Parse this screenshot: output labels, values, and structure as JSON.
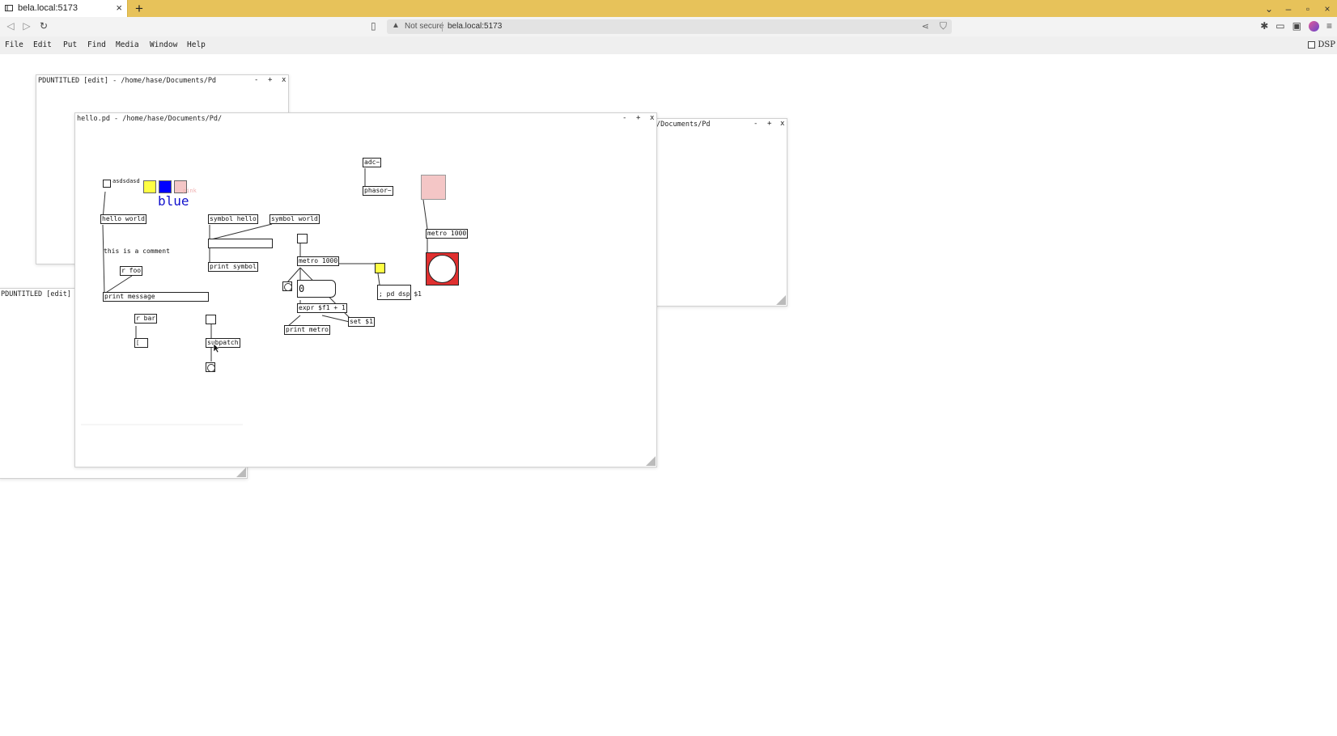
{
  "browser": {
    "tab_title": "bela.local:5173",
    "tab_close": "×",
    "new_tab": "+",
    "security_label": "Not secure",
    "url": "bela.local:5173",
    "win_controls": [
      "⌄",
      "–",
      "▫",
      "×"
    ]
  },
  "menu": {
    "items": [
      "File",
      "Edit",
      "Put",
      "Find",
      "Media",
      "Window",
      "Help"
    ],
    "dsp_label": "DSP"
  },
  "windows": {
    "untitled_top": {
      "title": "PDUNTITLED [edit] - /home/hase/Documents/Pd",
      "min": "-",
      "max": "+",
      "close": "x"
    },
    "untitled_left": {
      "title": "PDUNTITLED [edit] -"
    },
    "docs_right": {
      "title": "/Documents/Pd",
      "min": "-",
      "max": "+",
      "close": "x"
    },
    "hello": {
      "title": "hello.pd - /home/hase/Documents/Pd/",
      "min": "-",
      "max": "+",
      "close": "x"
    }
  },
  "patch": {
    "objects": {
      "adc": "adc~",
      "phasor": "phasor~",
      "hello_world": "hello world",
      "symbol_hello": "symbol hello",
      "symbol_world": "symbol world",
      "comment": "this is a comment",
      "r_foo": "r foo",
      "print_message": "print message",
      "print_symbol": "print symbol",
      "metro_1000_a": "metro 1000",
      "metro_1000_b": "metro 1000",
      "expr": "expr $f1 + 1",
      "set": "set $1",
      "print_metro": "print metro",
      "pd_dsp": "; pd dsp $1",
      "r_bar": "r bar",
      "subpatch": "subpatch",
      "toggle_label": "asdsdasd",
      "blue_label": "blue",
      "pink_label": "pink",
      "number": "0"
    },
    "colors": {
      "yellow": "#ffff44",
      "blue": "#0000ff",
      "pink": "#f4c6c6",
      "vu_red": "#e03030",
      "label_blue": "#1010cc"
    }
  }
}
